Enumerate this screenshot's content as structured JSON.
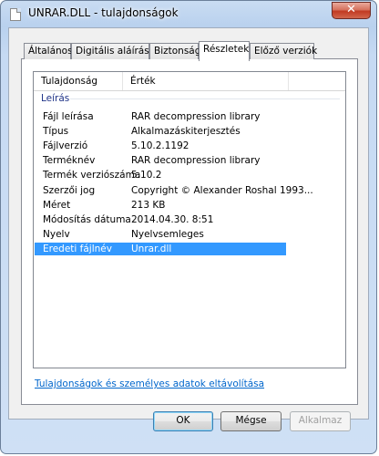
{
  "window": {
    "title": "UNRAR.DLL - tulajdonságok",
    "close_glyph": "✕"
  },
  "tabs": [
    {
      "label": "Általános"
    },
    {
      "label": "Digitális aláírások"
    },
    {
      "label": "Biztonság"
    },
    {
      "label": "Részletek",
      "active": true
    },
    {
      "label": "Előző verziók"
    }
  ],
  "details": {
    "columns": {
      "property": "Tulajdonság",
      "value": "Érték"
    },
    "group": "Leírás",
    "rows": [
      {
        "key": "Fájl leírása",
        "value": "RAR decompression library"
      },
      {
        "key": "Típus",
        "value": "Alkalmazáskiterjesztés"
      },
      {
        "key": "Fájlverzió",
        "value": "5.10.2.1192"
      },
      {
        "key": "Terméknév",
        "value": "RAR decompression library"
      },
      {
        "key": "Termék verziószáma",
        "value": "5.10.2"
      },
      {
        "key": "Szerzői jog",
        "value": "Copyright © Alexander Roshal 1993..."
      },
      {
        "key": "Méret",
        "value": "213 KB"
      },
      {
        "key": "Módosítás dátuma",
        "value": "2014.04.30. 8:51"
      },
      {
        "key": "Nyelv",
        "value": "Nyelvsemleges"
      },
      {
        "key": "Eredeti fájlnév",
        "value": "Unrar.dll",
        "selected": true
      }
    ]
  },
  "link": "Tulajdonságok és személyes adatok eltávolítása",
  "buttons": {
    "ok": "OK",
    "cancel": "Mégse",
    "apply": "Alkalmaz"
  }
}
